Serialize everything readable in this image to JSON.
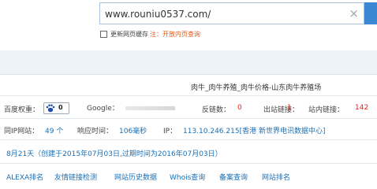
{
  "search": {
    "value": "www.rouniu0537.com/",
    "clear_icon": "close-icon"
  },
  "cache": {
    "label": "更新网页缓存",
    "note": "注：开放内页查询"
  },
  "site": {
    "title": "肉牛_肉牛养殖_肉牛价格-山东肉牛养殖场"
  },
  "metrics": {
    "baidu_label": "百度权重：",
    "baidu_value": "0",
    "google_label": "Google：",
    "backlinks_label": "反链数：",
    "backlinks_value": "0",
    "outlinks_label": "出站链接：",
    "outlinks_value": "1",
    "inlinks_label": "站内链接：",
    "inlinks_value": "142"
  },
  "server": {
    "same_ip_label": "同IP网站：",
    "same_ip_value": "49 个",
    "response_label": "响应时间：",
    "response_value": "106毫秒",
    "ip_label": "IP：",
    "ip_value": "113.10.246.215[香港 新世界电讯数据中心]"
  },
  "domain_age": {
    "text": "8月21天（创建于2015年07月03日,过期时间为2016年07月03日）"
  },
  "tools": [
    {
      "label": "ALEXA排名"
    },
    {
      "label": "友情链接检测"
    },
    {
      "label": "网站历史数据"
    },
    {
      "label": "Whois查询"
    },
    {
      "label": "备案查询"
    },
    {
      "label": "网站排名"
    }
  ],
  "colors": {
    "accent": "#3c87d4",
    "red": "#e8201c",
    "link": "#1a6fb5"
  }
}
